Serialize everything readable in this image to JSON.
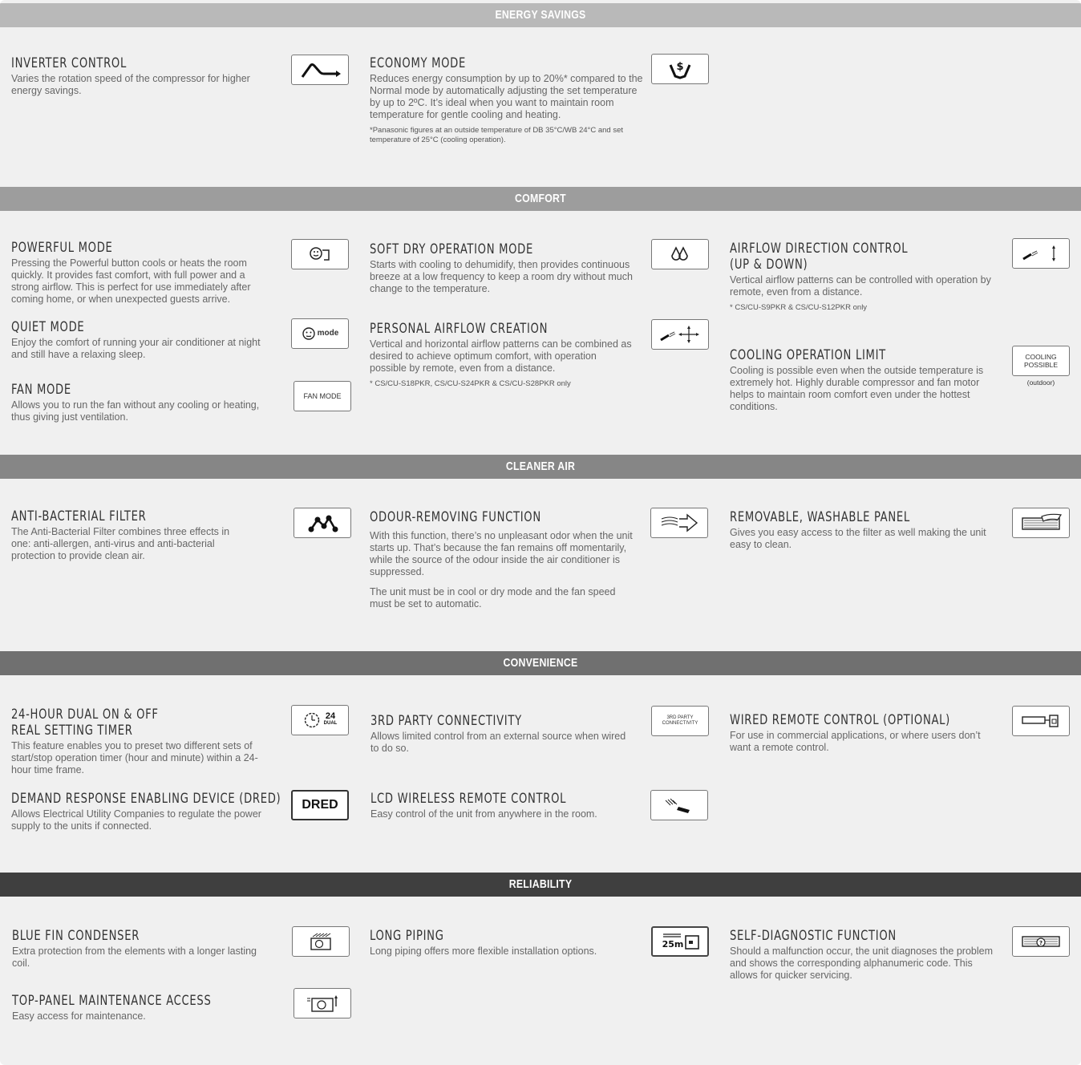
{
  "sections": [
    {
      "title": "ENERGY SAVINGS",
      "color": "#b9b9b9"
    },
    {
      "title": "COMFORT",
      "color": "#9d9d9d"
    },
    {
      "title": "CLEANER AIR",
      "color": "#868686"
    },
    {
      "title": "CONVENIENCE",
      "color": "#707070"
    },
    {
      "title": "RELIABILITY",
      "color": "#3f3f3f"
    }
  ],
  "features": {
    "inverter": {
      "title": "INVERTER CONTROL",
      "desc": "Varies the rotation speed of the compressor for higher energy savings.",
      "icon": "inverter-wave-icon"
    },
    "economy": {
      "title": "ECONOMY MODE",
      "desc": "Reduces energy consumption by up to 20%* compared to the Normal mode by automatically adjusting the set temperature by up to 2ºC. It’s ideal when you want to maintain room temperature for gentle cooling and heating.",
      "note": "*Panasonic figures at an outside temperature of DB 35°C/WB 24°C and set temperature of 25°C (cooling operation).",
      "icon": "hand-dollar-icon"
    },
    "powerful": {
      "title": "POWERFUL MODE",
      "desc": "Pressing the Powerful button cools or heats the room quickly. It provides fast comfort, with full power and a strong airflow. This is perfect for use immediately after coming home, or when unexpected guests arrive.",
      "icon": "powerful-face-icon"
    },
    "quiet": {
      "title": "QUIET MODE",
      "desc": "Enjoy the comfort of running your air conditioner at night and still have a relaxing sleep.",
      "icon": "quiet-mode-icon",
      "icon_text": "mode"
    },
    "fan": {
      "title": "FAN MODE",
      "desc": "Allows you to run the fan without any cooling or heating, thus giving just ventilation.",
      "icon_text": "FAN MODE"
    },
    "softdry": {
      "title": "SOFT DRY OPERATION MODE",
      "desc": "Starts with cooling to dehumidify, then provides continuous breeze at a low frequency to keep a room dry without much change to the temperature.",
      "icon": "droplets-icon"
    },
    "personal": {
      "title": "PERSONAL AIRFLOW CREATION",
      "desc": "Vertical and horizontal airflow patterns can be combined as desired to achieve optimum comfort, with operation possible by remote, even from a distance.",
      "note": "* CS/CU-S18PKR, CS/CU-S24PKR & CS/CU-S28PKR only",
      "icon": "airflow-cross-icon"
    },
    "airflowdir": {
      "title": "AIRFLOW DIRECTION CONTROL",
      "title2": "(UP & DOWN)",
      "desc": "Vertical airflow patterns can be controlled with operation by remote, even from a distance.",
      "note": "* CS/CU-S9PKR & CS/CU-S12PKR only",
      "icon": "airflow-updown-icon"
    },
    "coolinglimit": {
      "title": "COOLING OPERATION LIMIT",
      "desc": "Cooling is possible even when the outside temperature is extremely hot. Highly durable compressor and fan motor helps to maintain room comfort even under the hottest conditions.",
      "icon_text": "COOLING POSSIBLE",
      "icon_sub": "(outdoor)"
    },
    "antibac": {
      "title": "ANTI-BACTERIAL FILTER",
      "desc": "The Anti-Bacterial Filter combines three effects in one: anti-allergen, anti-virus and anti-bacterial protection to provide clean air.",
      "icon": "molecule-icon"
    },
    "odour": {
      "title": "ODOUR-REMOVING FUNCTION",
      "desc": "With this function, there’s no unpleasant odor when the unit starts up. That’s because the fan remains off momentarily, while the source of the odour inside the air conditioner is suppressed.",
      "desc2": "The unit must be in cool or dry mode and the fan speed must be set to automatic.",
      "icon": "odour-arrow-icon"
    },
    "panel": {
      "title": "REMOVABLE, WASHABLE PANEL",
      "desc": "Gives you easy access to the filter as well making the unit easy to clean.",
      "icon": "washable-panel-icon"
    },
    "timer": {
      "title": "24-HOUR DUAL ON & OFF",
      "title2": "REAL SETTING TIMER",
      "desc": "This feature enables you to preset two different sets of start/stop operation timer (hour and minute) within a 24-hour time frame.",
      "icon_num": "24",
      "icon_sub": "DUAL"
    },
    "dred": {
      "title": "DEMAND RESPONSE ENABLING DEVICE (DRED)",
      "desc": "Allows Electrical Utility Companies to regulate the power supply to the units if connected.",
      "icon_text": "DRED"
    },
    "thirdparty": {
      "title": "3RD PARTY CONNECTIVITY",
      "desc": "Allows limited control from an external source when wired to do so.",
      "icon_text": "3RD PARTY CONNECTIVITY"
    },
    "lcdremote": {
      "title": "LCD WIRELESS REMOTE CONTROL",
      "desc": "Easy control of the unit from anywhere in the room.",
      "icon": "wireless-remote-icon"
    },
    "wiredremote": {
      "title": "WIRED REMOTE CONTROL (OPTIONAL)",
      "desc": "For use in commercial applications, or where users don’t want a remote control.",
      "icon": "wired-remote-icon"
    },
    "bluefin": {
      "title": "BLUE FIN CONDENSER",
      "desc": "Extra protection from the elements with a longer lasting coil.",
      "icon": "condenser-icon"
    },
    "toppanel": {
      "title": "TOP-PANEL MAINTENANCE ACCESS",
      "desc": "Easy access for maintenance.",
      "icon": "top-panel-icon"
    },
    "piping": {
      "title": "LONG PIPING",
      "desc": "Long piping offers more flexible installation options.",
      "icon_text": "25m"
    },
    "selfdiag": {
      "title": "SELF-DIAGNOSTIC FUNCTION",
      "desc": "Should a malfunction occur, the unit diagnoses the problem and shows the corresponding alphanumeric code. This allows for quicker servicing.",
      "icon": "diagnostic-icon"
    }
  }
}
